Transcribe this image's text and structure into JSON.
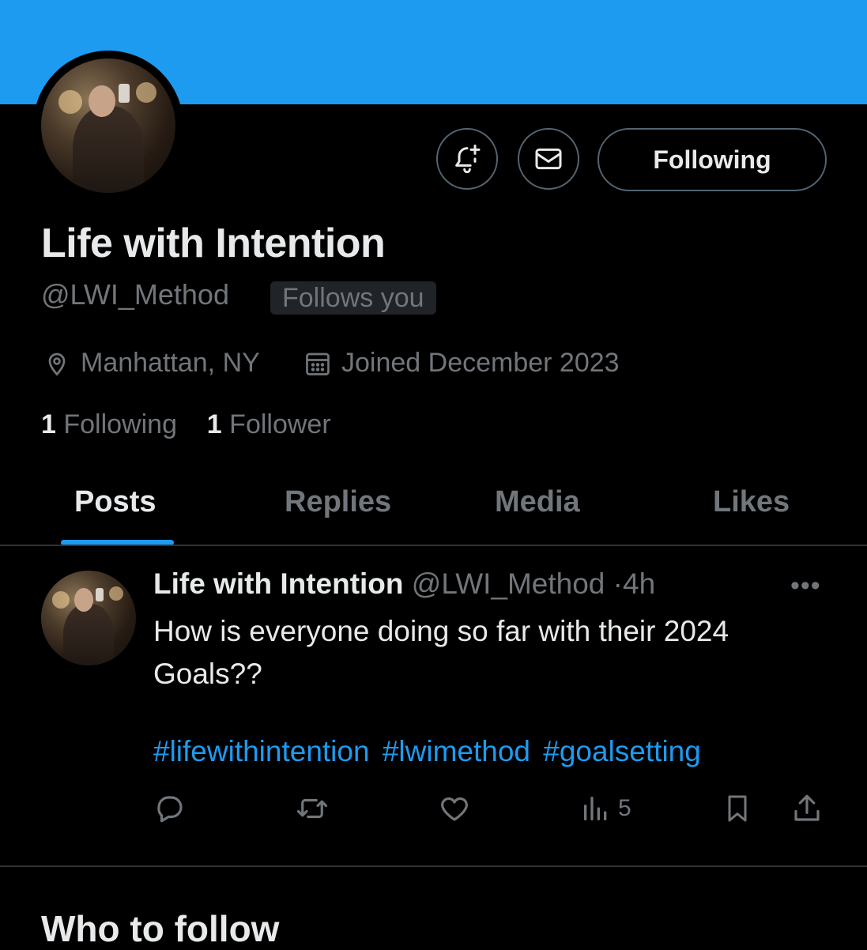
{
  "colors": {
    "banner": "#1d9bf0",
    "accent": "#1d9bf0",
    "muted": "#71767b",
    "background": "#000000"
  },
  "profile": {
    "display_name": "Life with Intention",
    "handle": "@LWI_Method",
    "follows_you": "Follows you",
    "location": "Manhattan, NY",
    "joined": "Joined December 2023",
    "following_count": "1",
    "following_label": "Following",
    "follower_count": "1",
    "follower_label": "Follower"
  },
  "actions": {
    "notify_icon": "bell-plus-icon",
    "message_icon": "envelope-icon",
    "follow_button": "Following"
  },
  "tabs": [
    {
      "label": "Posts",
      "active": true
    },
    {
      "label": "Replies",
      "active": false
    },
    {
      "label": "Media",
      "active": false
    },
    {
      "label": "Likes",
      "active": false
    }
  ],
  "post": {
    "author_name": "Life with Intention",
    "author_handle": "@LWI_Method",
    "separator": "·",
    "time": "4h",
    "text": "How is everyone doing so far with their 2024 Goals??",
    "hashtags": [
      "#lifewithintention",
      "#lwimethod",
      "#goalsetting"
    ],
    "views": "5",
    "action_icons": [
      "reply-icon",
      "repost-icon",
      "like-icon",
      "views-icon",
      "bookmark-icon",
      "share-icon"
    ]
  },
  "who_to_follow": "Who to follow"
}
